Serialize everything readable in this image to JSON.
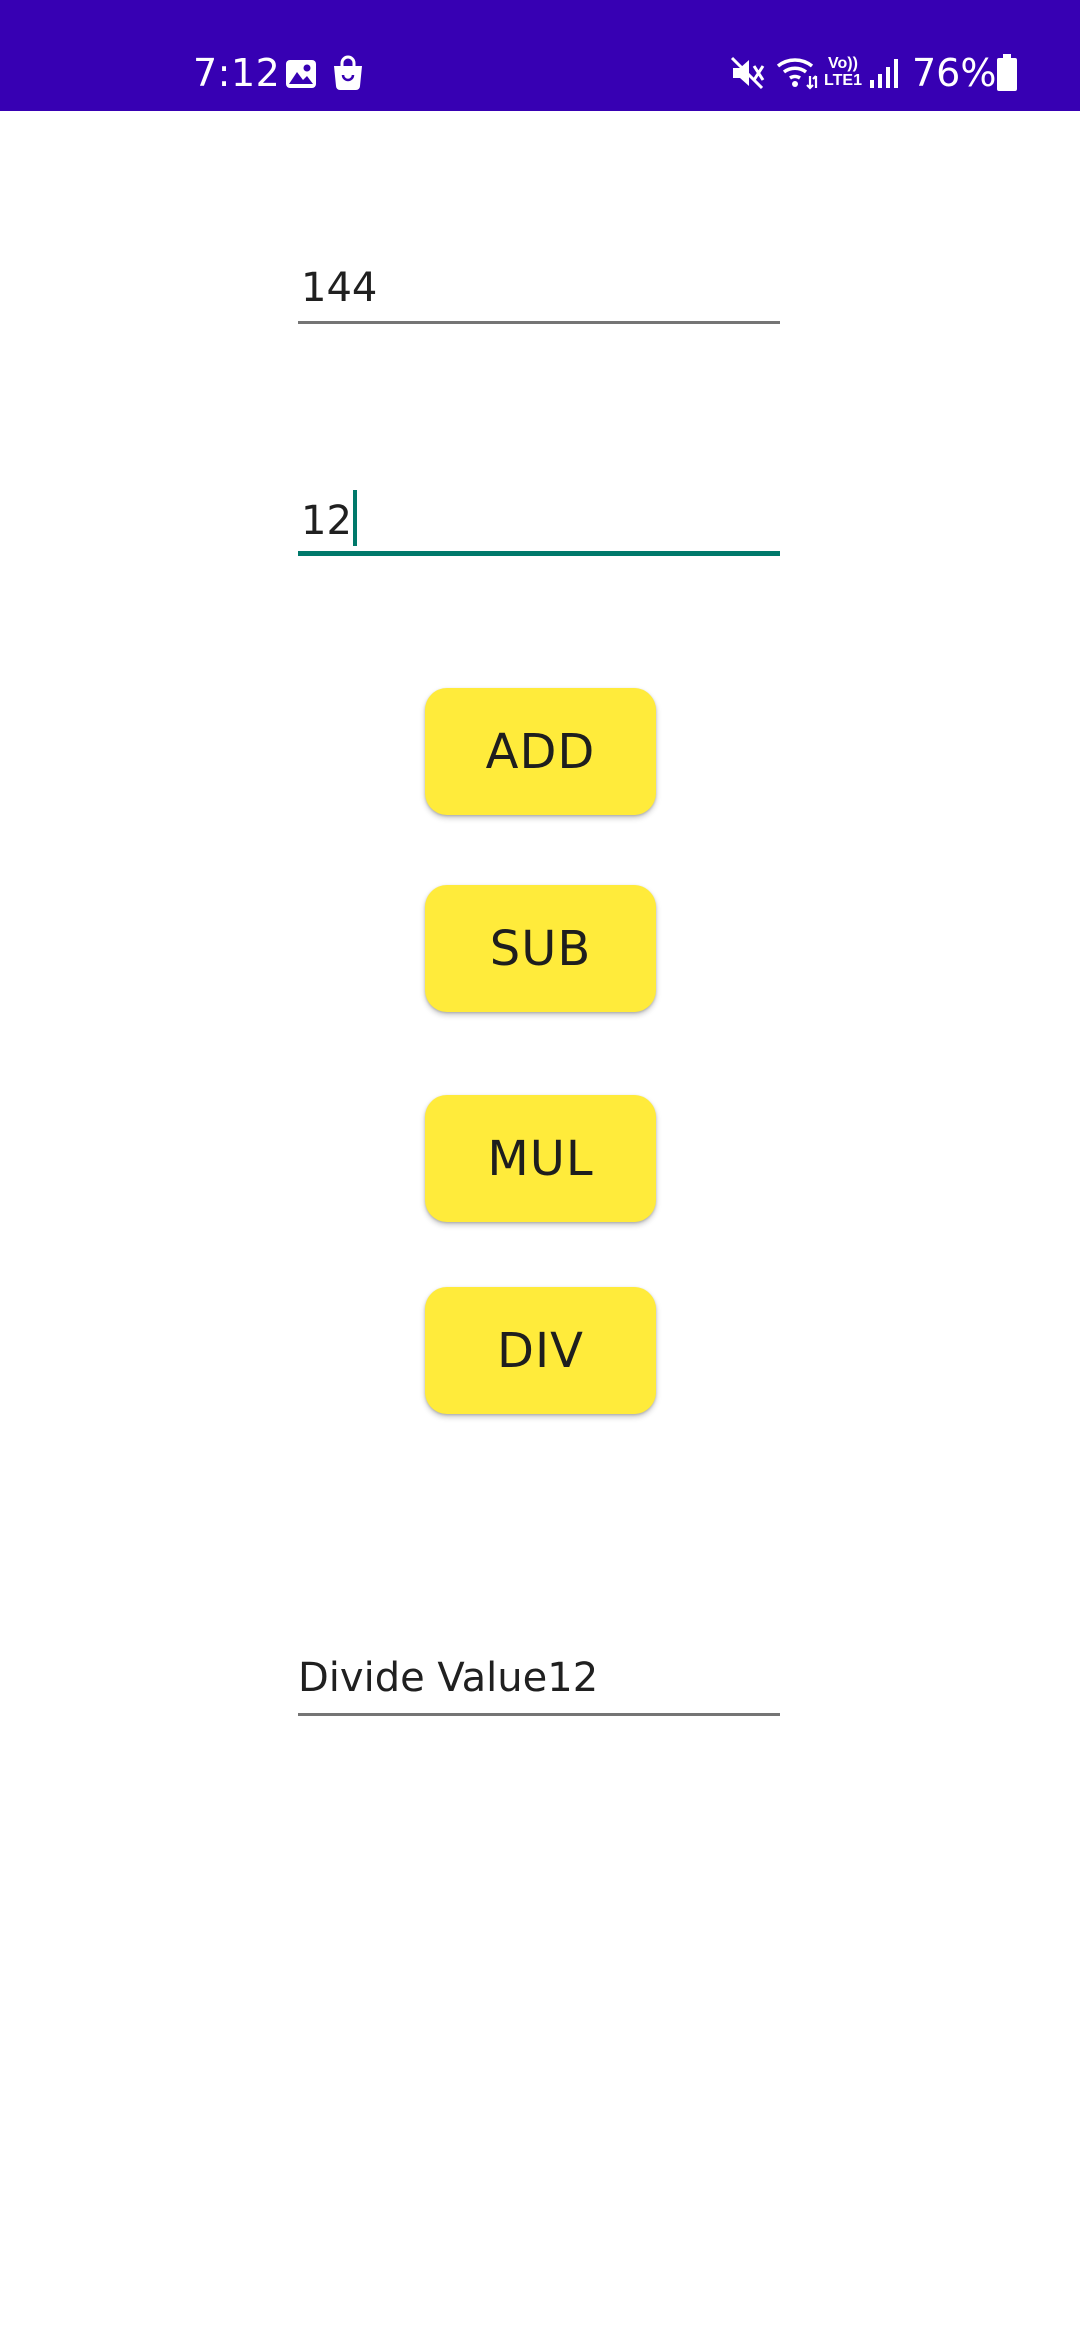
{
  "status_bar": {
    "time": "7:12",
    "battery_percent": "76%",
    "background_color": "#3700b3",
    "icons": [
      "gallery-icon",
      "shopping-bag-icon",
      "mute-icon",
      "wifi-icon",
      "volte-icon",
      "signal-icon",
      "battery-icon"
    ],
    "volte_label_top": "Vo))",
    "volte_label_bottom": "LTE1"
  },
  "form": {
    "first_number": {
      "value": "144",
      "placeholder": ""
    },
    "second_number": {
      "value": "12",
      "placeholder": "",
      "focused": true,
      "accent_color": "#00796b"
    }
  },
  "buttons": {
    "add_label": "ADD",
    "sub_label": "SUB",
    "mul_label": "MUL",
    "div_label": "DIV",
    "color": "#ffeb3b"
  },
  "result": {
    "text": "Divide Value12"
  }
}
